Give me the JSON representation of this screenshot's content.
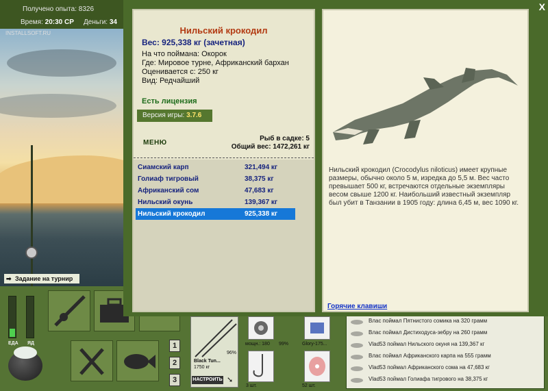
{
  "topbar": {
    "experience_label": "Получено опыта:",
    "experience_value": "8326",
    "time_label": "Время:",
    "time_value": "20:30 СР",
    "money_label": "Деньги:",
    "money_value": "34"
  },
  "scene": {
    "watermark": "INSTALLSOFT.RU",
    "tournament_label": "Задание на турнир"
  },
  "meters": [
    {
      "label": "ЕДА",
      "level_pct": 20
    },
    {
      "label": "ЯД",
      "level_pct": 0
    }
  ],
  "tackle": {
    "rod_name": "Black Tun...",
    "rod_weight": "1750 кг",
    "rod_pct": "96%",
    "setup_button": "НАСТРОИТЬ",
    "reel_power": "мощн.: 180",
    "reel_pct": "99%",
    "line_name": "Glory-175...",
    "hook_count": "3 шт.",
    "bait_count": "52 шт.",
    "slots": [
      "1",
      "2",
      "3"
    ]
  },
  "log": [
    "Влас поймал Пятнистого сомика на 320 грамм",
    "Влас поймал Дистиходуса-зебру на 260 грамм",
    "Vlad53 поймал Нильского окуня на 139,367 кг",
    "Влас поймал Африканского карпа на 555 грамм",
    "Vlad53 поймал Африканского сома на 47,683 кг",
    "Vlad53 поймал Голиафа тигрового на 38,375 кг"
  ],
  "dialog": {
    "close": "X",
    "fish_name": "Нильский крокодил",
    "weight": "Вес: 925,338 кг (зачетная)",
    "caught_on": "На что поймана: Окорок",
    "where": "Где: Мировое турне, Африканский бархан",
    "value": "Оценивается с: 250 кг",
    "kind": "Вид: Редчайший",
    "license": "Есть лицензия",
    "version_label": "Версия игры:",
    "version_value": "3.7.6",
    "menu": "МЕНЮ",
    "keepnet_count": "Рыб в садке: 5",
    "keepnet_total": "Общий вес: 1472,261 кг",
    "catch_list": [
      {
        "name": "Сиамский карп",
        "weight": "321,494 кг"
      },
      {
        "name": "Голиаф тигровый",
        "weight": "38,375 кг"
      },
      {
        "name": "Африканский сом",
        "weight": "47,683 кг"
      },
      {
        "name": "Нильский окунь",
        "weight": "139,367 кг"
      },
      {
        "name": "Нильский крокодил",
        "weight": "925,338 кг"
      }
    ],
    "selected_index": 4,
    "description": "Нильский крокодил (Crocodylus niloticus) имеет крупные размеры, обычно около 5 м, изредка до 5,5 м. Вес часто превышает 500 кг, встречаются отдельные экземпляры весом свыше 1200 кг. Наибольший известный экземпляр был убит в Танзании в 1905 году: длина 6,45 м, вес 1090 кг.",
    "hotkeys": "Горячие клавиши"
  },
  "colors": {
    "accent": "#1678d8",
    "title": "#b23a12",
    "weight": "#16237e",
    "panel": "#e9e7cf",
    "frame": "#4a6a2a"
  }
}
